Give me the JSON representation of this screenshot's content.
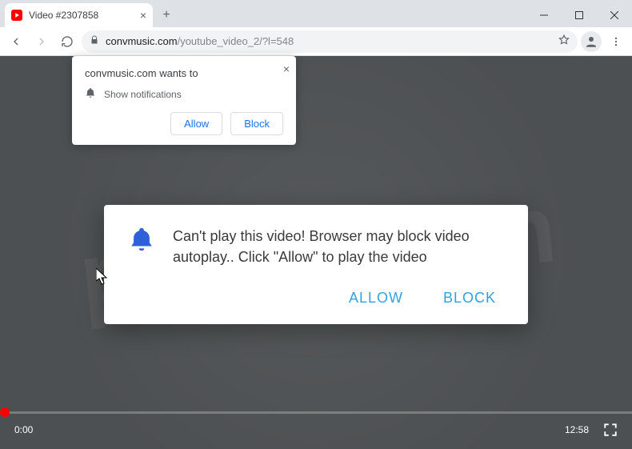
{
  "tab": {
    "title": "Video #2307858",
    "favicon_color": "#ff0000"
  },
  "window_controls": {
    "minimize": "min",
    "maximize": "max",
    "close": "close"
  },
  "nav": {
    "back": "back",
    "forward": "forward",
    "reload": "reload"
  },
  "omnibox": {
    "lock": "lock",
    "domain": "convmusic.com",
    "path": "/youtube_video_2/?l=548",
    "star": "star"
  },
  "toolbar": {
    "avatar": "user",
    "menu": "menu"
  },
  "notification_prompt": {
    "title": "convmusic.com wants to",
    "permission_line": "Show notifications",
    "allow_label": "Allow",
    "block_label": "Block",
    "close": "×"
  },
  "page_dialog": {
    "message": "Can't play this video! Browser may block video autoplay.. Click \"Allow\" to play the video",
    "allow_label": "ALLOW",
    "block_label": "BLOCK"
  },
  "video": {
    "current_time": "0:00",
    "duration": "12:58",
    "fullscreen": "fullscreen"
  },
  "watermark": "pcrisk.com"
}
